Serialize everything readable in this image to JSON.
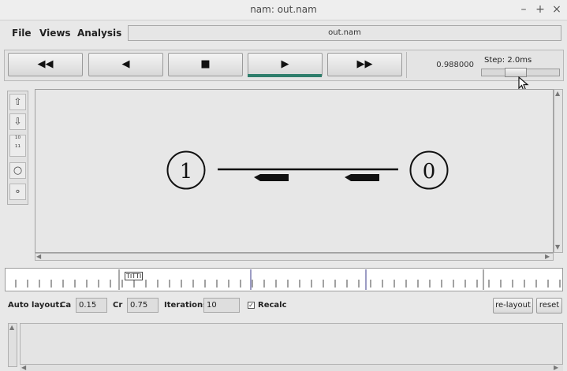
{
  "window": {
    "title": "nam: out.nam",
    "controls": [
      "–",
      "+",
      "×"
    ]
  },
  "menu": {
    "file": "File",
    "views": "Views",
    "analysis": "Analysis",
    "filename": "out.nam"
  },
  "toolbar": {
    "rewind": "◀◀",
    "back": "◀",
    "stop": "■",
    "play": "▶",
    "forward": "▶▶",
    "time": "0.988000",
    "step_label": "Step: 2.0ms",
    "step_slider_position": 0.42
  },
  "tools": {
    "zoom_in": "⇧",
    "zoom_out": "⇩",
    "mark_top": "¹⁰",
    "mark_bottom": "¹¹",
    "circle_large": "○",
    "circle_small": "∘"
  },
  "network": {
    "nodes": [
      {
        "id": "1",
        "label": "1"
      },
      {
        "id": "0",
        "label": "0"
      }
    ],
    "link": {
      "from": "1",
      "to": "0"
    },
    "packets": [
      {
        "direction": "left"
      },
      {
        "direction": "left"
      }
    ]
  },
  "timeline": {
    "label": "TITTI"
  },
  "autolayout": {
    "label": "Auto layout:",
    "ca_label": "Ca",
    "ca_value": "0.15",
    "cr_label": "Cr",
    "cr_value": "0.75",
    "iterations_label": "Iterations",
    "iterations_value": "10",
    "recalc_label": "Recalc",
    "recalc_checked": "✓",
    "relayout_label": "re-layout",
    "reset_label": "reset"
  },
  "colors": {
    "play_indicator": "#2e7d6b",
    "time_text": "#333333"
  }
}
